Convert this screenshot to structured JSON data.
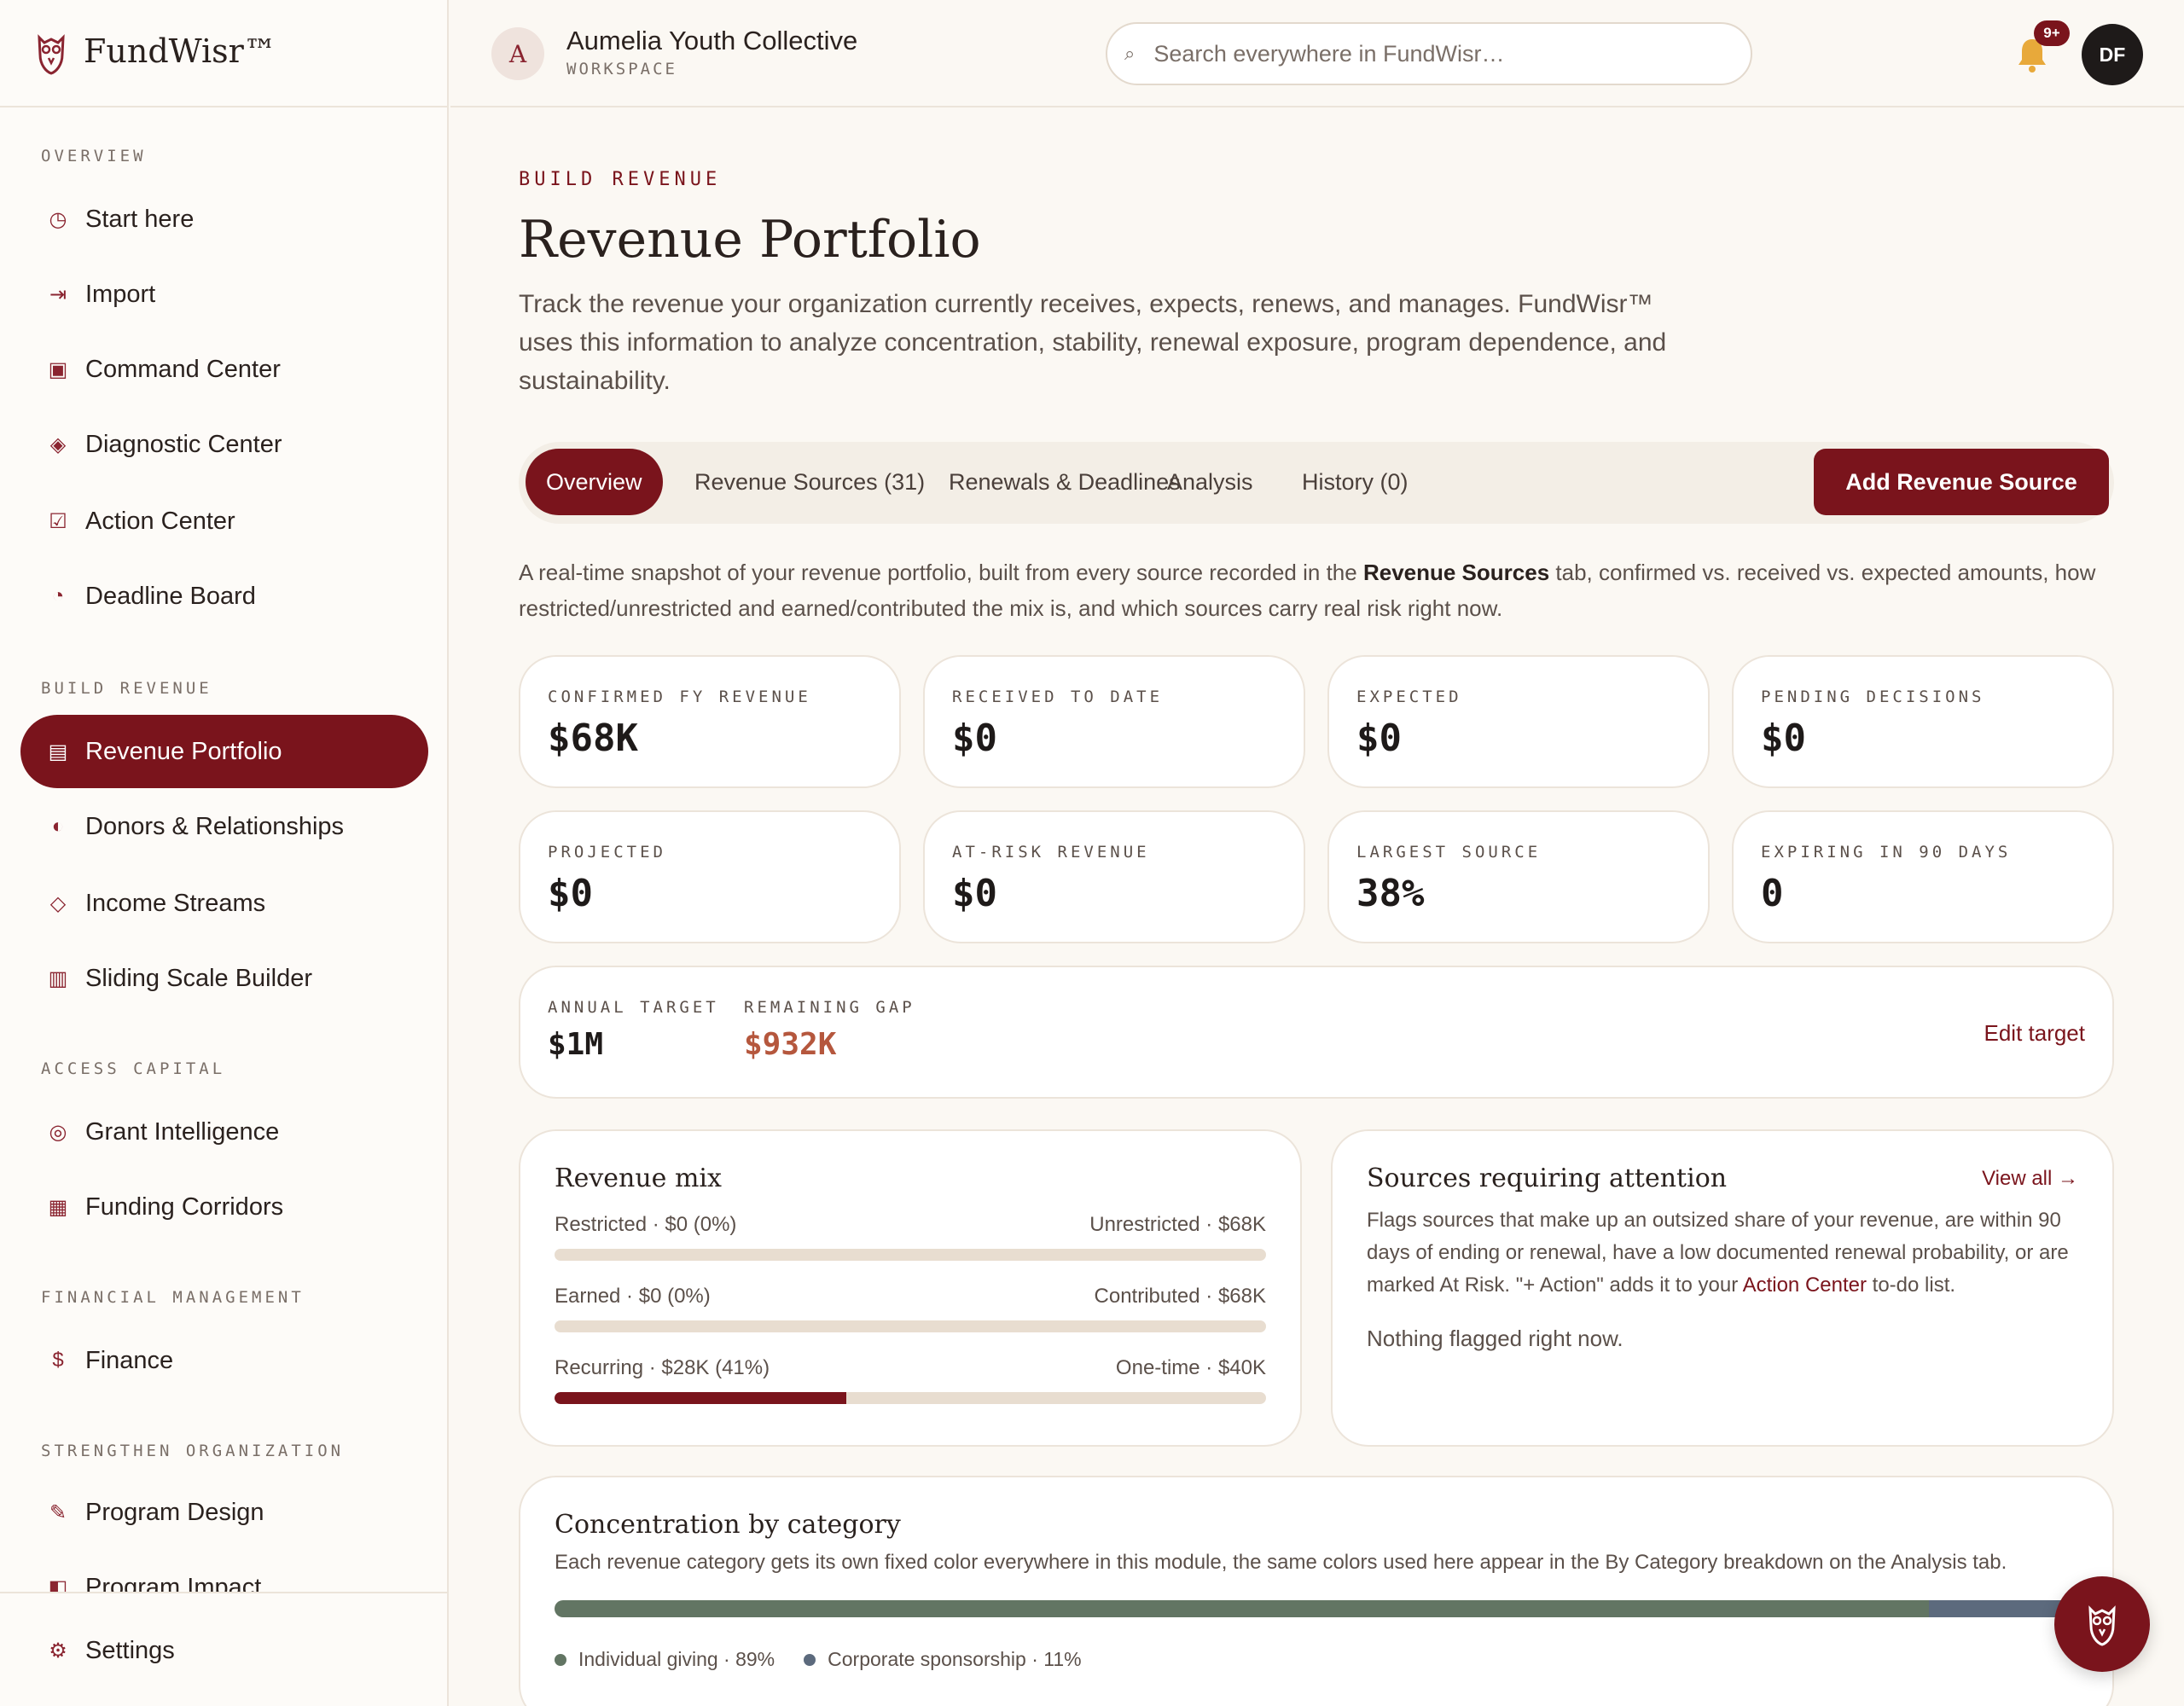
{
  "brand": {
    "name": "FundWisr™",
    "icon": "owl-logo-icon"
  },
  "workspace": {
    "initial": "A",
    "name": "Aumelia Youth Collective",
    "label": "WORKSPACE"
  },
  "search": {
    "placeholder": "Search everywhere in FundWisr…",
    "value": ""
  },
  "notifications": {
    "badge": "9+"
  },
  "user": {
    "initials": "DF"
  },
  "sidebar": {
    "sections": [
      {
        "title": "OVERVIEW",
        "items": [
          {
            "label": "Start here",
            "icon": "clock-icon",
            "glyph": "◷"
          },
          {
            "label": "Import",
            "icon": "import-arrow-icon",
            "glyph": "⇥"
          },
          {
            "label": "Command Center",
            "icon": "square-target-icon",
            "glyph": "▣"
          },
          {
            "label": "Diagnostic Center",
            "icon": "diamond-icon",
            "glyph": "◈"
          },
          {
            "label": "Action Center",
            "icon": "checkbox-icon",
            "glyph": "☑"
          },
          {
            "label": "Deadline Board",
            "icon": "pie-clock-icon",
            "glyph": "◔"
          }
        ]
      },
      {
        "title": "BUILD REVENUE",
        "items": [
          {
            "label": "Revenue Portfolio",
            "icon": "list-icon",
            "glyph": "▤",
            "active": true
          },
          {
            "label": "Donors & Relationships",
            "icon": "half-circle-icon",
            "glyph": "◐"
          },
          {
            "label": "Income Streams",
            "icon": "outline-diamond-icon",
            "glyph": "◇"
          },
          {
            "label": "Sliding Scale Builder",
            "icon": "columns-icon",
            "glyph": "▥"
          }
        ]
      },
      {
        "title": "ACCESS CAPITAL",
        "items": [
          {
            "label": "Grant Intelligence",
            "icon": "target-icon",
            "glyph": "◎"
          },
          {
            "label": "Funding Corridors",
            "icon": "grid-icon",
            "glyph": "▦"
          }
        ]
      },
      {
        "title": "FINANCIAL MANAGEMENT",
        "items": [
          {
            "label": "Finance",
            "icon": "dollar-icon",
            "glyph": "$"
          }
        ]
      },
      {
        "title": "STRENGTHEN ORGANIZATION",
        "items": [
          {
            "label": "Program Design",
            "icon": "pencil-icon",
            "glyph": "✎"
          },
          {
            "label": "Program Impact",
            "icon": "half-square-icon",
            "glyph": "◧"
          }
        ]
      }
    ],
    "settings": {
      "label": "Settings",
      "icon": "gear-icon",
      "glyph": "⚙"
    }
  },
  "page": {
    "eyebrow": "BUILD REVENUE",
    "title": "Revenue Portfolio",
    "description": "Track the revenue your organization currently receives, expects, renews, and manages. FundWisr™ uses this information to analyze concentration, stability, renewal exposure, program dependence, and sustainability."
  },
  "tabs": [
    {
      "label": "Overview",
      "active": true
    },
    {
      "label": "Revenue Sources (31)"
    },
    {
      "label": "Renewals & Deadlines"
    },
    {
      "label": "Analysis"
    },
    {
      "label": "History (0)"
    }
  ],
  "add_button": "Add Revenue Source",
  "snapshot": {
    "before": "A real-time snapshot of your revenue portfolio, built from every source recorded in the ",
    "bold": "Revenue Sources",
    "after": " tab, confirmed vs. received vs. expected amounts, how restricted/unrestricted and earned/contributed the mix is, and which sources carry real risk right now."
  },
  "stats": [
    {
      "label": "CONFIRMED FY REVENUE",
      "value": "$68K"
    },
    {
      "label": "RECEIVED TO DATE",
      "value": "$0"
    },
    {
      "label": "EXPECTED",
      "value": "$0"
    },
    {
      "label": "PENDING DECISIONS",
      "value": "$0"
    },
    {
      "label": "PROJECTED",
      "value": "$0"
    },
    {
      "label": "AT-RISK REVENUE",
      "value": "$0"
    },
    {
      "label": "LARGEST SOURCE",
      "value": "38%"
    },
    {
      "label": "EXPIRING IN 90 DAYS",
      "value": "0"
    }
  ],
  "target": {
    "annual_label": "ANNUAL TARGET",
    "annual_value": "$1M",
    "gap_label": "REMAINING GAP",
    "gap_value": "$932K",
    "gap_color": "#b5573d",
    "edit_label": "Edit target"
  },
  "revenue_mix": {
    "title": "Revenue mix",
    "rows": [
      {
        "left": "Restricted · $0 (0%)",
        "right": "Unrestricted · $68K",
        "fill": 0
      },
      {
        "left": "Earned · $0 (0%)",
        "right": "Contributed · $68K",
        "fill": 0
      },
      {
        "left": "Recurring · $28K (41%)",
        "right": "One-time · $40K",
        "fill": 0.41
      }
    ]
  },
  "attention": {
    "title": "Sources requiring attention",
    "view_all": "View all →",
    "desc_before": "Flags sources that make up an outsized share of your revenue, are within 90 days of ending or renewal, have a low documented renewal probability, or are marked At Risk. \"+ Action\" adds it to your ",
    "desc_link": "Action Center",
    "desc_after": " to-do list.",
    "empty": "Nothing flagged right now."
  },
  "concentration": {
    "title": "Concentration by category",
    "description": "Each revenue category gets its own fixed color everywhere in this module, the same colors used here appear in the By Category breakdown on the Analysis tab.",
    "segments": [
      {
        "label": "Individual giving · 89%",
        "share": 0.89,
        "color": "#627563"
      },
      {
        "label": "Corporate sponsorship · 11%",
        "share": 0.11,
        "color": "#5c6a7d"
      }
    ]
  },
  "colors": {
    "accent": "#7a141c",
    "background": "#fbf8f3"
  }
}
